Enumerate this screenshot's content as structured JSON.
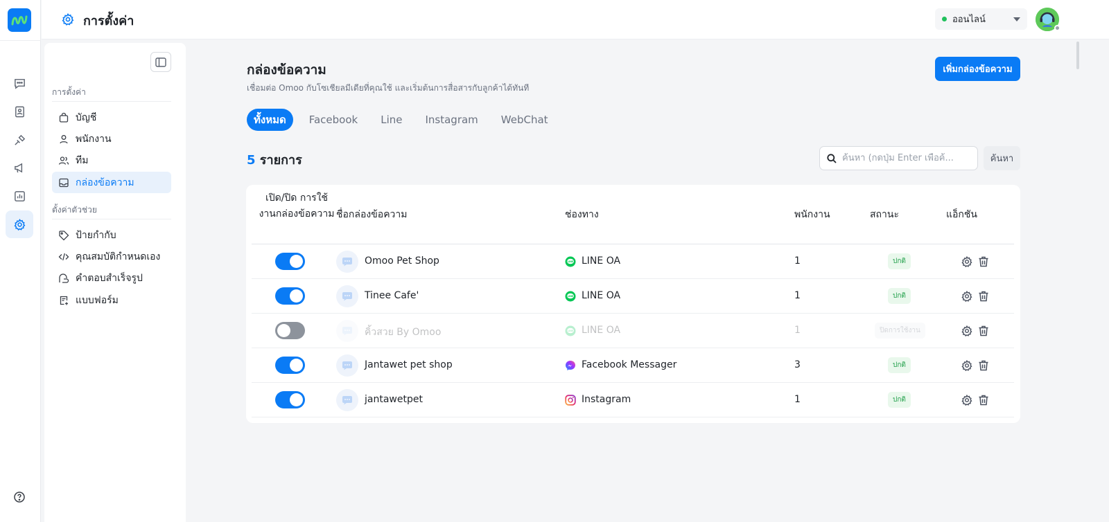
{
  "header": {
    "title": "การตั้งค่า",
    "status_label": "ออนไลน์",
    "colors": {
      "accent": "#0a7bf5",
      "online": "#20c05c"
    }
  },
  "rail": {
    "items": [
      "chat-icon",
      "contacts-icon",
      "integration-icon",
      "broadcast-icon",
      "report-icon",
      "settings-icon"
    ],
    "active": "settings-icon"
  },
  "sidebar": {
    "section1_label": "การตั้งค่า",
    "section1_items": [
      {
        "label": "บัญชี",
        "icon": "bag-icon"
      },
      {
        "label": "พนักงาน",
        "icon": "user-icon"
      },
      {
        "label": "ทีม",
        "icon": "team-icon"
      },
      {
        "label": "กล่องข้อความ",
        "icon": "inbox-icon"
      }
    ],
    "section2_label": "ตั้งค่าตัวช่วย",
    "section2_items": [
      {
        "label": "ป้ายกำกับ",
        "icon": "tag-icon"
      },
      {
        "label": "คุณสมบัติกำหนดเอง",
        "icon": "code-icon"
      },
      {
        "label": "คำตอบสำเร็จรูป",
        "icon": "quick-reply-icon"
      },
      {
        "label": "แบบฟอร์ม",
        "icon": "form-icon"
      }
    ]
  },
  "main": {
    "title": "กล่องข้อความ",
    "subtitle": "เชื่อมต่อ Omoo กับโซเชียลมีเดียที่คุณใช้ และเริ่มต้นการสื่อสารกับลูกค้าได้ทันที",
    "add_button": "เพิ่มกล่องข้อความ",
    "tabs": [
      "ทั้งหมด",
      "Facebook",
      "Line",
      "Instagram",
      "WebChat"
    ],
    "active_tab": "ทั้งหมด",
    "count": "5",
    "count_suffix": " รายการ",
    "search_placeholder": "ค้นหา (กดปุ่ม Enter เพื่อค้...",
    "search_button": "ค้นหา"
  },
  "table": {
    "headers": {
      "toggle": "เปิด/ปิด การใช้งานกล่องข้อความ",
      "name": "ชื่อกล่องข้อความ",
      "channel": "ช่องทาง",
      "staff": "พนักงาน",
      "status": "สถานะ",
      "actions": "แอ็กชัน"
    },
    "rows": [
      {
        "enabled": true,
        "name": "Omoo Pet Shop",
        "channel": "LINE OA",
        "channel_icon": "line-icon",
        "staff": "1",
        "status": "ปกติ"
      },
      {
        "enabled": true,
        "name": "Tinee Cafe'",
        "channel": "LINE OA",
        "channel_icon": "line-icon",
        "staff": "1",
        "status": "ปกติ"
      },
      {
        "enabled": false,
        "name": "คิ้วสวย By Omoo",
        "channel": "LINE OA",
        "channel_icon": "line-icon",
        "staff": "1",
        "status": "ปิดการใช้งาน"
      },
      {
        "enabled": true,
        "name": "Jantawet pet shop",
        "channel": "Facebook Messager",
        "channel_icon": "messenger-icon",
        "staff": "3",
        "status": "ปกติ"
      },
      {
        "enabled": true,
        "name": "jantawetpet",
        "channel": "Instagram",
        "channel_icon": "instagram-icon",
        "staff": "1",
        "status": "ปกติ"
      }
    ]
  }
}
